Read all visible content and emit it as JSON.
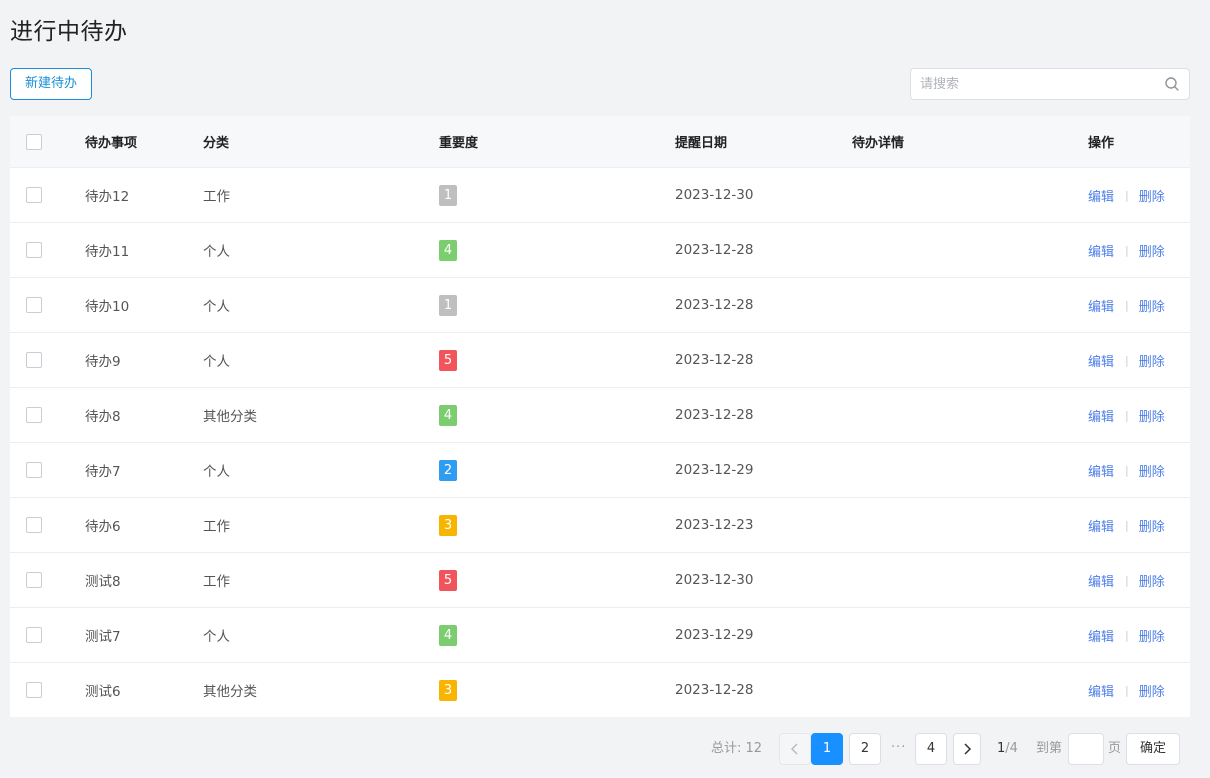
{
  "page_title": "进行中待办",
  "new_button_label": "新建待办",
  "search": {
    "placeholder": "请搜索",
    "value": ""
  },
  "columns": {
    "name": "待办事项",
    "category": "分类",
    "importance": "重要度",
    "date": "提醒日期",
    "detail": "待办详情",
    "ops": "操作"
  },
  "row_actions": {
    "edit": "编辑",
    "separator": "|",
    "delete": "删除"
  },
  "importance_colors": {
    "1": "#bfbfbf",
    "2": "#2e9cf0",
    "3": "#f7b500",
    "4": "#7ccd6f",
    "5": "#f2545b"
  },
  "rows": [
    {
      "name": "待办12",
      "category": "工作",
      "importance": "1",
      "date": "2023-12-30",
      "detail": ""
    },
    {
      "name": "待办11",
      "category": "个人",
      "importance": "4",
      "date": "2023-12-28",
      "detail": ""
    },
    {
      "name": "待办10",
      "category": "个人",
      "importance": "1",
      "date": "2023-12-28",
      "detail": ""
    },
    {
      "name": "待办9",
      "category": "个人",
      "importance": "5",
      "date": "2023-12-28",
      "detail": ""
    },
    {
      "name": "待办8",
      "category": "其他分类",
      "importance": "4",
      "date": "2023-12-28",
      "detail": ""
    },
    {
      "name": "待办7",
      "category": "个人",
      "importance": "2",
      "date": "2023-12-29",
      "detail": ""
    },
    {
      "name": "待办6",
      "category": "工作",
      "importance": "3",
      "date": "2023-12-23",
      "detail": ""
    },
    {
      "name": "测试8",
      "category": "工作",
      "importance": "5",
      "date": "2023-12-30",
      "detail": ""
    },
    {
      "name": "测试7",
      "category": "个人",
      "importance": "4",
      "date": "2023-12-29",
      "detail": ""
    },
    {
      "name": "测试6",
      "category": "其他分类",
      "importance": "3",
      "date": "2023-12-28",
      "detail": ""
    }
  ],
  "pagination": {
    "total_label": "总计: 12",
    "pages": [
      "1",
      "2",
      "4"
    ],
    "active_page": "1",
    "ellipsis": "···",
    "current": "1",
    "page_count": "/4",
    "goto_label": "到第",
    "goto_value": "",
    "page_suffix": "页",
    "confirm_label": "确定"
  }
}
